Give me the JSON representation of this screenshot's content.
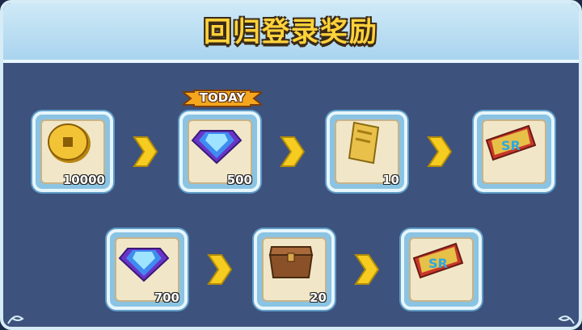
{
  "title": "回归登录奖励",
  "today_badge": "TODAY",
  "rewards": [
    {
      "item": "gold-coin",
      "qty": "10000"
    },
    {
      "item": "purple-diamond",
      "qty": "500"
    },
    {
      "item": "gold-ticket",
      "qty": "10"
    },
    {
      "item": "sr-ticket",
      "qty": ""
    },
    {
      "item": "purple-diamond",
      "qty": "700"
    },
    {
      "item": "wooden-chest",
      "qty": "20"
    },
    {
      "item": "sr-ticket",
      "qty": ""
    }
  ],
  "colors": {
    "title": "#ffd23a",
    "arrow": "#f5cc1f",
    "panel": "#3d527c"
  },
  "icons": [
    "coin-icon",
    "diamond-icon",
    "ticket-icon",
    "sr-ticket-icon",
    "chest-icon",
    "arrow-icon"
  ]
}
